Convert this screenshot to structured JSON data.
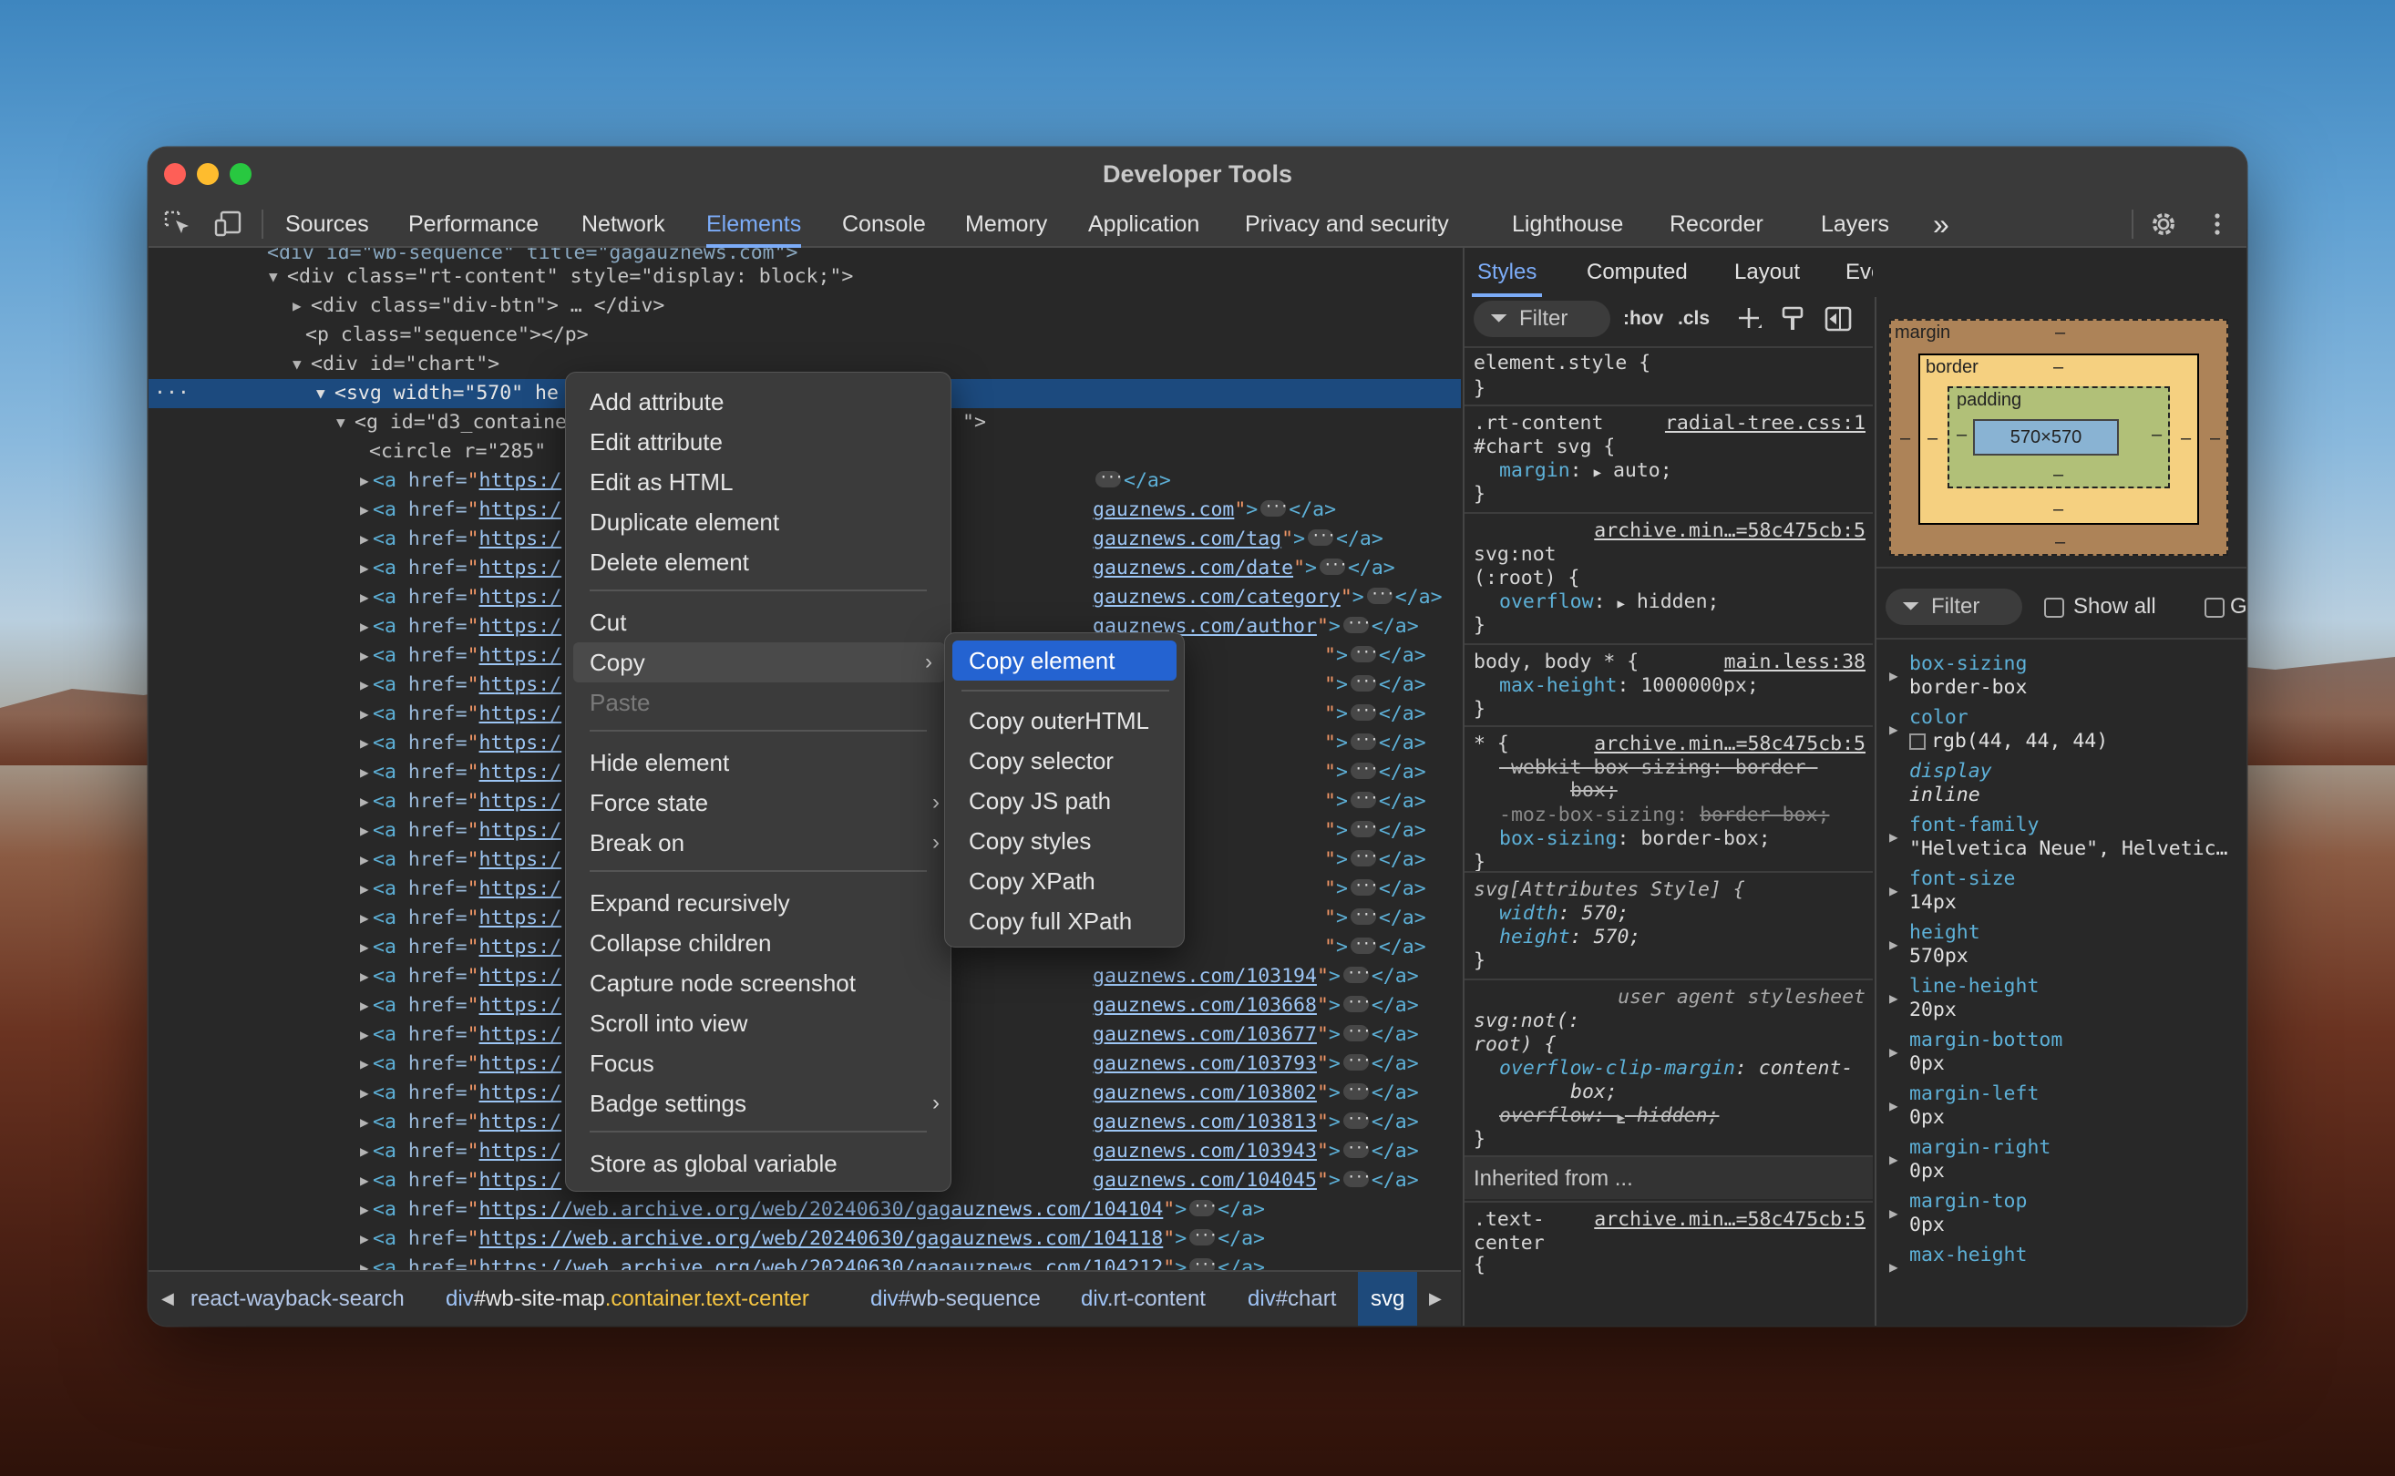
{
  "window": {
    "title": "Developer Tools"
  },
  "toolbar": {
    "tabs": [
      "Sources",
      "Performance",
      "Network",
      "Elements",
      "Console",
      "Memory",
      "Application",
      "Privacy and security",
      "Lighthouse",
      "Recorder",
      "Layers"
    ],
    "active_tab": "Elements",
    "overflow": "»",
    "icons": [
      "inspect-element-icon",
      "device-toolbar-icon",
      "gear-icon",
      "more-vertical-icon"
    ]
  },
  "dom": {
    "rows": [
      {
        "t": "<div id=\"wb-sequence\" title=\"gagauznews.com\">"
      },
      {
        "a": "rt-content",
        "t": "<div class=\"rt-content\" style=\"display: block;\">"
      },
      {
        "t": "<div class=\"div-btn\"> … </div>"
      },
      {
        "t": "<p class=\"sequence\"></p>"
      },
      {
        "t": "<div id=\"chart\">"
      },
      {
        "t": "<svg width=\"570\" he"
      },
      {
        "t": "<g id=\"d3_containe"
      },
      {
        "t": "<circle r=\"285\""
      }
    ],
    "selected_prefix": "···",
    "link_prefix": "https:/",
    "link_tails": [
      "</a>",
      "gauznews.com",
      "gauznews.com/tag",
      "gauznews.com/date",
      "gauznews.com/category",
      "gauznews.com/author",
      "",
      "",
      "",
      "",
      "",
      "",
      "",
      "",
      "",
      "",
      "",
      "gauznews.com/103194",
      "gauznews.com/103668",
      "gauznews.com/103677",
      "gauznews.com/103793",
      "gauznews.com/103802",
      "gauznews.com/103813",
      "gauznews.com/103943",
      "gauznews.com/104045"
    ],
    "full_links": [
      "https://web.archive.org/web/20240630/gagauznews.com/104104",
      "https://web.archive.org/web/20240630/gagauznews.com/104118",
      "https://web.archive.org/web/20240630/gagauznews.com/104212"
    ],
    "close_a": "</a>",
    "href_attr": "href="
  },
  "breadcrumbs": [
    {
      "label": "react-wayback-search"
    },
    {
      "tag": "div",
      "id": "#wb-site-map",
      "cls": ".container.text-center"
    },
    {
      "tag": "div",
      "id": "#wb-sequence"
    },
    {
      "tag": "div",
      "cls": ".rt-content"
    },
    {
      "tag": "div",
      "id": "#chart"
    },
    {
      "label": "svg"
    }
  ],
  "styles": {
    "tabs": [
      "Styles",
      "Computed",
      "Layout",
      "Event Listeners"
    ],
    "overflow": "»",
    "filter_placeholder": "Filter",
    "hov": ":hov",
    "cls": ".cls",
    "rules": {
      "element_style": "element.style {",
      "close": "}",
      "r1_sel1": ".rt-content",
      "r1_sel2": "#chart svg {",
      "r1_src": "radial-tree.css:1",
      "r1_prop": "margin",
      "r1_val": "auto;",
      "r2_src": "archive.min…=58c475cb:5",
      "r2_sel1": "svg:not",
      "r2_sel2": "(:root) {",
      "r2_prop": "overflow",
      "r2_val": "hidden;",
      "r3_sel": "body, body * {",
      "r3_src": "main.less:38",
      "r3_prop": "max-height",
      "r3_val": "1000000px;",
      "r4_sel": "* {",
      "r4_src": "archive.min…=58c475cb:5",
      "r4_l1": "-webkit-box-sizing: border-",
      "r4_l2": "box;",
      "r4_l3a": "-moz-box-sizing:",
      "r4_l3b": "border-box;",
      "r4_prop": "box-sizing",
      "r4_val": "border-box;",
      "r5_sel": "svg[Attributes Style] {",
      "r5_p1": "width",
      "r5_v1": "570;",
      "r5_p2": "height",
      "r5_v2": "570;",
      "r6_src": "user agent stylesheet",
      "r6_sel1": "svg:not(:",
      "r6_sel2": "root) {",
      "r6_p1": "overflow-clip-margin",
      "r6_v1a": "content-",
      "r6_v1b": "box;",
      "r6_p2": "overflow",
      "r6_v2": "hidden;",
      "inherited": "Inherited from ...",
      "r7_sel1": ".text-",
      "r7_sel2": "center",
      "r7_sel3": "{",
      "r7_src": "archive.min…=58c475cb:5"
    }
  },
  "computed": {
    "box": {
      "margin": "margin",
      "border": "border",
      "padding": "padding",
      "content": "570×570",
      "dash": "–"
    },
    "filter_placeholder": "Filter",
    "show_all": "Show all",
    "group": "G.",
    "props": [
      {
        "name": "box-sizing",
        "value": "border-box"
      },
      {
        "name": "color",
        "value": "rgb(44, 44, 44)",
        "swatch": "#2c2c2c"
      },
      {
        "name": "display",
        "value": "inline",
        "italic": true
      },
      {
        "name": "font-family",
        "value": "\"Helvetica Neue\", Helvetic…"
      },
      {
        "name": "font-size",
        "value": "14px"
      },
      {
        "name": "height",
        "value": "570px"
      },
      {
        "name": "line-height",
        "value": "20px"
      },
      {
        "name": "margin-bottom",
        "value": "0px"
      },
      {
        "name": "margin-left",
        "value": "0px"
      },
      {
        "name": "margin-right",
        "value": "0px"
      },
      {
        "name": "margin-top",
        "value": "0px"
      },
      {
        "name": "max-height",
        "value": ""
      }
    ]
  },
  "context_menu": {
    "items": [
      "Add attribute",
      "Edit attribute",
      "Edit as HTML",
      "Duplicate element",
      "Delete element",
      "Cut",
      "Copy",
      "Paste",
      "Hide element",
      "Force state",
      "Break on",
      "Expand recursively",
      "Collapse children",
      "Capture node screenshot",
      "Scroll into view",
      "Focus",
      "Badge settings",
      "Store as global variable"
    ]
  },
  "copy_submenu": {
    "items": [
      "Copy element",
      "Copy outerHTML",
      "Copy selector",
      "Copy JS path",
      "Copy styles",
      "Copy XPath",
      "Copy full XPath"
    ]
  }
}
